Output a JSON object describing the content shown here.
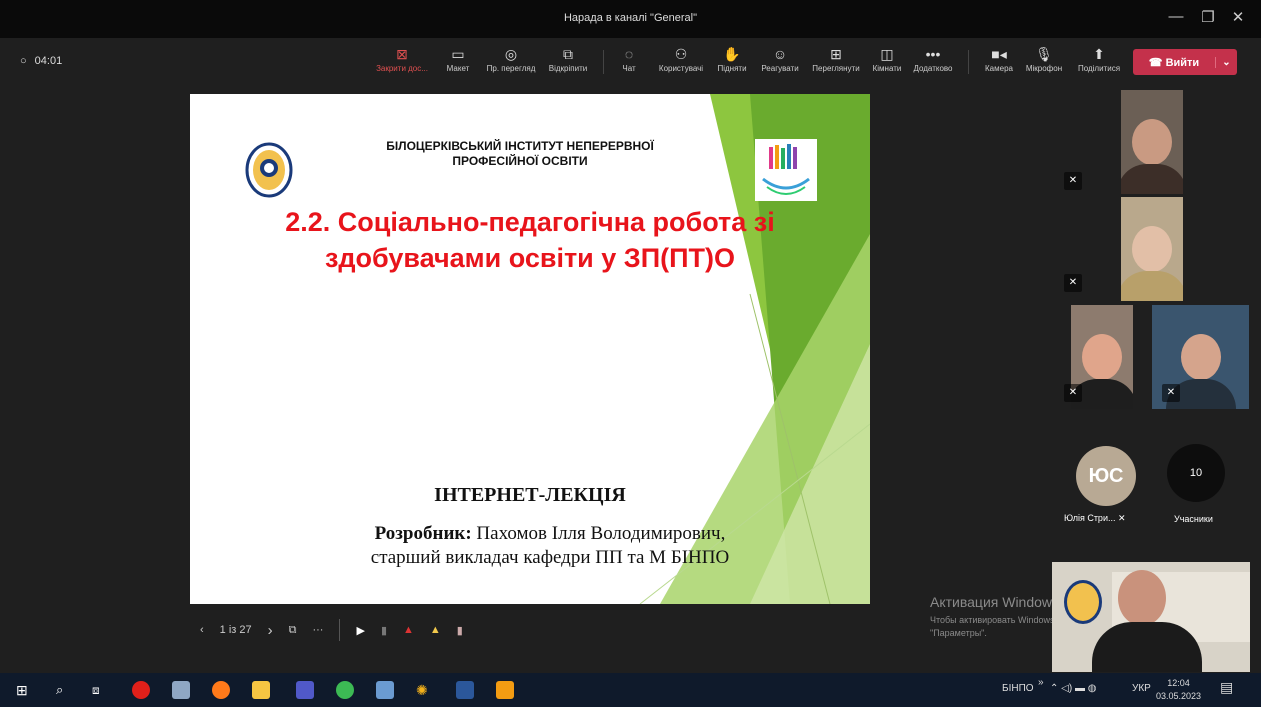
{
  "window": {
    "title": "Нарада в каналі \"General\""
  },
  "meeting": {
    "timer": "04:01",
    "toolbar": [
      {
        "label": "Закрити дос...",
        "icon": "close-share-icon"
      },
      {
        "label": "Макет",
        "icon": "layout-icon"
      },
      {
        "label": "Пр. перегляд",
        "icon": "eye-icon"
      },
      {
        "label": "Відкріпити",
        "icon": "popout-icon"
      },
      {
        "label": "Чат",
        "icon": "chat-icon"
      },
      {
        "label": "Користувачі",
        "icon": "people-icon"
      },
      {
        "label": "Підняти",
        "icon": "hand-icon"
      },
      {
        "label": "Реагувати",
        "icon": "smile-icon"
      },
      {
        "label": "Переглянути",
        "icon": "grid-icon"
      },
      {
        "label": "Кімнати",
        "icon": "rooms-icon"
      },
      {
        "label": "Додатково",
        "icon": "more-icon"
      },
      {
        "label": "Камера",
        "icon": "camera-icon"
      },
      {
        "label": "Мікрофон",
        "icon": "mic-icon"
      },
      {
        "label": "Поділитися",
        "icon": "share-icon"
      }
    ],
    "leave_label": "Вийти",
    "accent_leave": "#c4314b"
  },
  "slide": {
    "institute": "БІЛОЦЕРКІВСЬКИЙ ІНСТИТУТ НЕПЕРЕРВНОЇ ПРОФЕСІЙНОЇ ОСВІТИ",
    "title_line1": "2.2. Соціально-педагогічна робота зі",
    "title_line2": "здобувачами освіти у ЗП(ПТ)О",
    "lecture": "ІНТЕРНЕТ-ЛЕКЦІЯ",
    "author_label": "Розробник:",
    "author_name": " Пахомов Ілля Володимирович,",
    "author_position": "старший викладач кафедри ПП та М БІНПО",
    "title_color": "#e8141b"
  },
  "presenter_controls": {
    "page": "1 із 27"
  },
  "participants": {
    "avatar_initials": "ЮС",
    "avatar_name": "Юлія Стри...",
    "count": "10",
    "count_label": "Учасники"
  },
  "activation": {
    "title": "Активация Windows",
    "line1": "Чтобы активировать Windows, перейдите в раздел",
    "line2": "\"Параметры\"."
  },
  "taskbar": {
    "tray_label": "БІНПО",
    "lang": "УКР",
    "time": "12:04",
    "date": "03.05.2023"
  }
}
